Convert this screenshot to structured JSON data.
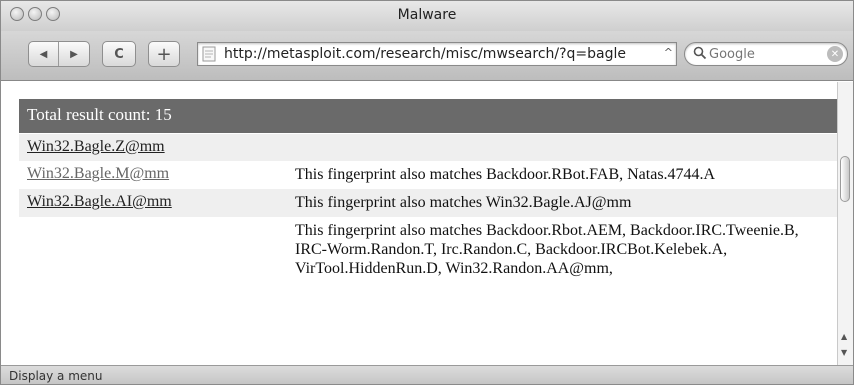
{
  "window": {
    "title": "Malware"
  },
  "toolbar": {
    "back_glyph": "◀",
    "forward_glyph": "▶",
    "reload_glyph": "C",
    "add_glyph": "+",
    "url": "http://metasploit.com/research/misc/mwsearch/?q=bagle",
    "url_dropdown_glyph": "^",
    "search_placeholder": "Google",
    "search_icon": "magnifier-icon",
    "clear_icon": "clear-icon"
  },
  "results": {
    "header": "Total result count: 15",
    "rows": [
      {
        "name": "Win32.Bagle.Z@mm",
        "desc": ""
      },
      {
        "name": "Win32.Bagle.M@mm",
        "desc": "This fingerprint also matches Backdoor.RBot.FAB, Natas.4744.A"
      },
      {
        "name": "Win32.Bagle.AI@mm",
        "desc": "This fingerprint also matches Win32.Bagle.AJ@mm"
      },
      {
        "name": "",
        "desc": "This fingerprint also matches Backdoor.Rbot.AEM, Backdoor.IRC.Tweenie.B, IRC-Worm.Randon.T, Irc.Randon.C, Backdoor.IRCBot.Kelebek.A, VirTool.HiddenRun.D, Win32.Randon.AA@mm,"
      }
    ]
  },
  "status": {
    "text": "Display a menu"
  }
}
